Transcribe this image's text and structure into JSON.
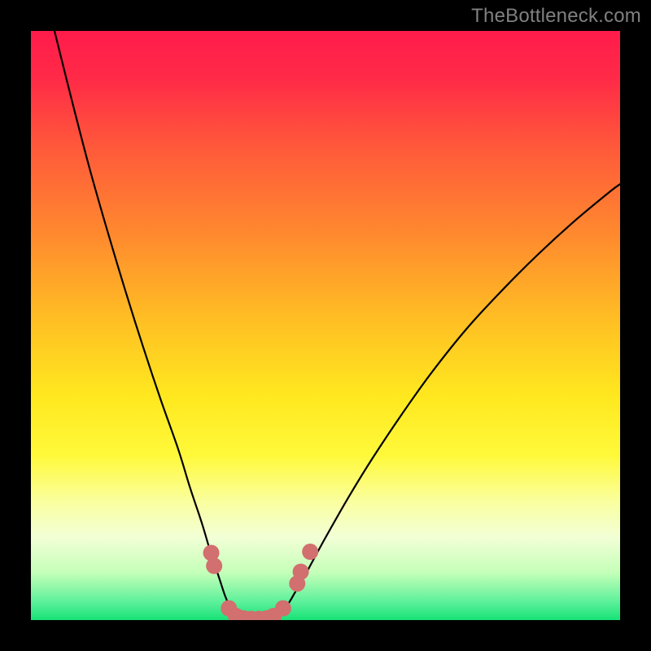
{
  "watermark": "TheBottleneck.com",
  "chart_data": {
    "type": "line",
    "title": "",
    "xlabel": "",
    "ylabel": "",
    "xlim": [
      0,
      100
    ],
    "ylim": [
      0,
      100
    ],
    "background_gradient": {
      "stops": [
        {
          "offset": 0.0,
          "color": "#ff1b4b"
        },
        {
          "offset": 0.08,
          "color": "#ff2a47"
        },
        {
          "offset": 0.2,
          "color": "#ff5a3a"
        },
        {
          "offset": 0.35,
          "color": "#ff8b2e"
        },
        {
          "offset": 0.5,
          "color": "#ffc223"
        },
        {
          "offset": 0.62,
          "color": "#ffe81f"
        },
        {
          "offset": 0.72,
          "color": "#fff93a"
        },
        {
          "offset": 0.8,
          "color": "#faffa0"
        },
        {
          "offset": 0.86,
          "color": "#f2ffd6"
        },
        {
          "offset": 0.92,
          "color": "#c4ffb8"
        },
        {
          "offset": 0.97,
          "color": "#5bf09a"
        },
        {
          "offset": 1.0,
          "color": "#17e277"
        }
      ]
    },
    "series": [
      {
        "name": "left-branch",
        "stroke": "#000000",
        "stroke_width": 2.2,
        "points": [
          {
            "x": 4.0,
            "y": 100.0
          },
          {
            "x": 7.0,
            "y": 88.0
          },
          {
            "x": 10.0,
            "y": 76.5
          },
          {
            "x": 13.0,
            "y": 66.0
          },
          {
            "x": 16.0,
            "y": 56.0
          },
          {
            "x": 19.0,
            "y": 46.5
          },
          {
            "x": 22.0,
            "y": 37.5
          },
          {
            "x": 25.0,
            "y": 29.0
          },
          {
            "x": 27.0,
            "y": 22.5
          },
          {
            "x": 29.0,
            "y": 16.5
          },
          {
            "x": 30.5,
            "y": 11.5
          },
          {
            "x": 32.0,
            "y": 7.0
          },
          {
            "x": 33.0,
            "y": 4.0
          },
          {
            "x": 34.0,
            "y": 1.8
          },
          {
            "x": 35.0,
            "y": 0.6
          },
          {
            "x": 36.0,
            "y": 0.2
          }
        ]
      },
      {
        "name": "right-branch",
        "stroke": "#000000",
        "stroke_width": 2.2,
        "points": [
          {
            "x": 41.0,
            "y": 0.2
          },
          {
            "x": 42.0,
            "y": 0.8
          },
          {
            "x": 43.5,
            "y": 2.5
          },
          {
            "x": 45.0,
            "y": 5.0
          },
          {
            "x": 47.0,
            "y": 8.5
          },
          {
            "x": 50.0,
            "y": 14.0
          },
          {
            "x": 54.0,
            "y": 21.0
          },
          {
            "x": 58.0,
            "y": 27.5
          },
          {
            "x": 63.0,
            "y": 35.0
          },
          {
            "x": 68.0,
            "y": 42.0
          },
          {
            "x": 74.0,
            "y": 49.5
          },
          {
            "x": 80.0,
            "y": 56.0
          },
          {
            "x": 86.0,
            "y": 62.0
          },
          {
            "x": 92.0,
            "y": 67.5
          },
          {
            "x": 98.0,
            "y": 72.5
          },
          {
            "x": 100.0,
            "y": 74.0
          }
        ]
      }
    ],
    "markers": {
      "name": "highlight-markers",
      "fill": "#d26f6f",
      "radius": 10,
      "points": [
        {
          "x": 30.6,
          "y": 11.4
        },
        {
          "x": 31.1,
          "y": 9.2
        },
        {
          "x": 33.6,
          "y": 2.0
        },
        {
          "x": 34.8,
          "y": 0.7
        },
        {
          "x": 36.1,
          "y": 0.3
        },
        {
          "x": 37.4,
          "y": 0.2
        },
        {
          "x": 38.7,
          "y": 0.2
        },
        {
          "x": 40.0,
          "y": 0.3
        },
        {
          "x": 41.2,
          "y": 0.7
        },
        {
          "x": 42.8,
          "y": 2.0
        },
        {
          "x": 45.2,
          "y": 6.2
        },
        {
          "x": 45.8,
          "y": 8.2
        },
        {
          "x": 47.4,
          "y": 11.6
        }
      ]
    }
  }
}
